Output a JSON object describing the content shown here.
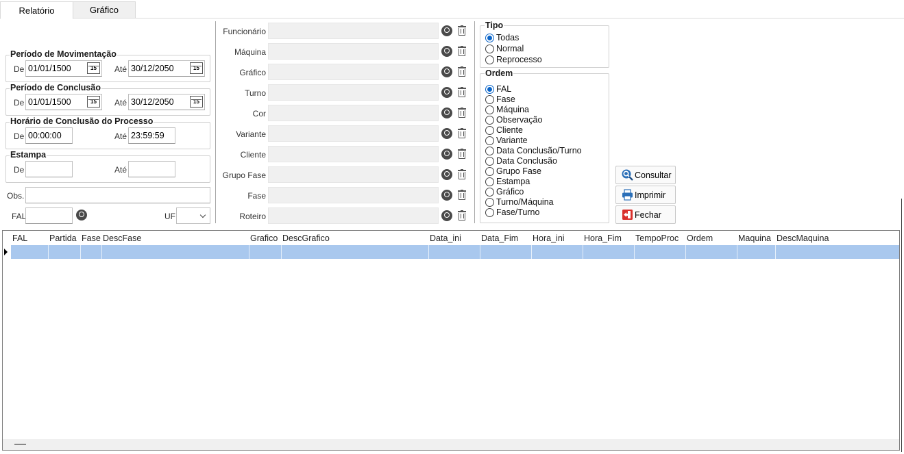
{
  "tabs": [
    "Relatório",
    "Gráfico"
  ],
  "periodo_movimentacao": {
    "title": "Período de Movimentação",
    "de_label": "De",
    "de_value": "01/01/1500",
    "ate_label": "Até",
    "ate_value": "30/12/2050"
  },
  "periodo_conclusao": {
    "title": "Período de Conclusão",
    "de_label": "De",
    "de_value": "01/01/1500",
    "ate_label": "Até",
    "ate_value": "30/12/2050"
  },
  "horario_conclusao": {
    "title": "Horário de Conclusão do Processo",
    "de_label": "De",
    "de_value": "00:00:00",
    "ate_label": "Até",
    "ate_value": "23:59:59"
  },
  "estampa": {
    "title": "Estampa",
    "de_label": "De",
    "de_value": "",
    "ate_label": "Até",
    "ate_value": ""
  },
  "obs": {
    "label": "Obs.",
    "value": ""
  },
  "fal": {
    "label": "FAL",
    "value": ""
  },
  "uf": {
    "label": "UF",
    "value": ""
  },
  "calendar_icon": "calendar-icon",
  "filters": [
    {
      "label": "Funcionário"
    },
    {
      "label": "Máquina"
    },
    {
      "label": "Gráfico"
    },
    {
      "label": "Turno"
    },
    {
      "label": "Cor"
    },
    {
      "label": "Variante"
    },
    {
      "label": "Cliente"
    },
    {
      "label": "Grupo Fase"
    },
    {
      "label": "Fase"
    },
    {
      "label": "Roteiro"
    }
  ],
  "tipo": {
    "title": "Tipo",
    "options": [
      "Todas",
      "Normal",
      "Reprocesso"
    ],
    "selected": "Todas"
  },
  "ordem": {
    "title": "Ordem",
    "options": [
      "FAL",
      "Fase",
      "Máquina",
      "Observação",
      "Cliente",
      "Variante",
      "Data Conclusão/Turno",
      "Data Conclusão",
      "Grupo Fase",
      "Estampa",
      "Gráfico",
      "Turno/Máquina",
      "Fase/Turno"
    ],
    "selected": "FAL"
  },
  "buttons": {
    "consultar": "Consultar",
    "imprimir": "Imprimir",
    "fechar": "Fechar"
  },
  "grid": {
    "columns": [
      "FAL",
      "Partida",
      "Fase",
      "DescFase",
      "Grafico",
      "DescGrafico",
      "Data_ini",
      "Data_Fim",
      "Hora_ini",
      "Hora_Fim",
      "TempoProc",
      "Ordem",
      "Maquina",
      "DescMaquina"
    ]
  },
  "colors": {
    "selection_row": "#a9c8ee",
    "radio_accent": "#0a64c8",
    "close_red": "#d9302c",
    "print_blue": "#2a6fb8"
  }
}
